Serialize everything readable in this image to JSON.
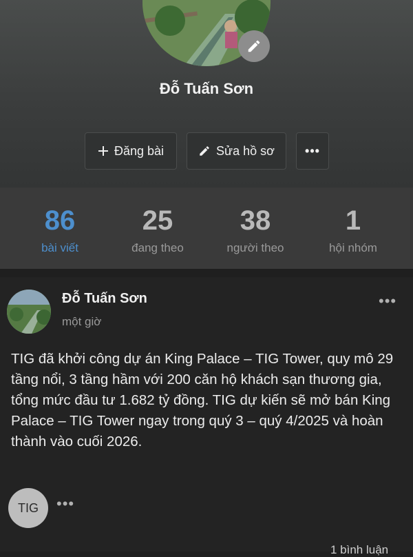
{
  "profile": {
    "name": "Đỗ Tuấn Sơn"
  },
  "actions": {
    "post_label": "Đăng bài",
    "edit_label": "Sửa hồ sơ",
    "more_label": "•••"
  },
  "stats": [
    {
      "value": "86",
      "label": "bài viết"
    },
    {
      "value": "25",
      "label": "đang theo"
    },
    {
      "value": "38",
      "label": "người theo"
    },
    {
      "value": "1",
      "label": "hội nhóm"
    }
  ],
  "post": {
    "author": "Đỗ Tuấn Sơn",
    "time": "một giờ",
    "more_label": "•••",
    "text": "TIG đã khởi công dự án King Palace – TIG Tower, quy mô 29 tầng nổi, 3 tầng hầm với 200 căn hộ khách sạn thương gia, tổng mức đầu tư 1.682 tỷ đồng. TIG dự kiến sẽ mở bán King Palace – TIG Tower ngay trong quý 3 – quý 4/2025 và hoàn thành vào cuối 2026.",
    "comment_avatar_text": "TIG",
    "comment_more_label": "•••",
    "comment_count": "1 bình luận"
  },
  "colors": {
    "accent": "#4d8fcd",
    "background": "#1f1f1f"
  },
  "icons": {
    "edit_avatar": "pencil-icon",
    "post": "plus-icon",
    "edit": "pencil-icon"
  }
}
